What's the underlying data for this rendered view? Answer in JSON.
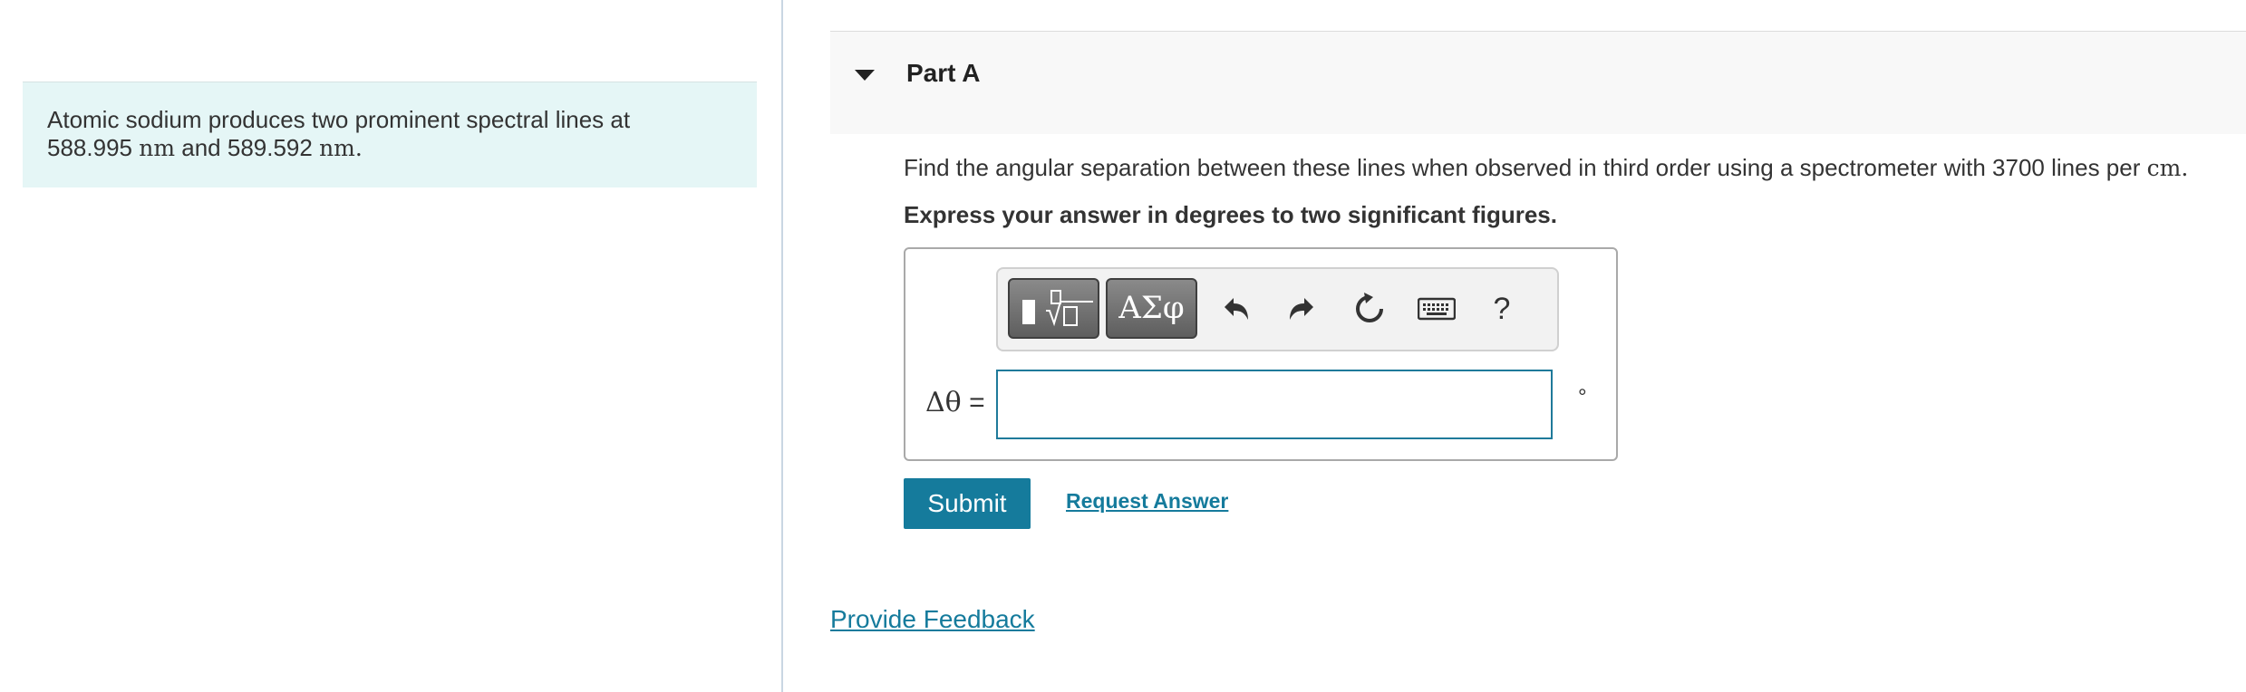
{
  "intro": {
    "text_prefix": "Atomic sodium produces two prominent spectral lines at",
    "line1_value": "588.995",
    "line1_unit": "nm",
    "and_text": " and ",
    "line2_value": "589.592",
    "line2_unit": "nm",
    "end": "."
  },
  "part": {
    "title": "Part A",
    "question_prefix": "Find the angular separation between these lines when observed in third order using a spectrometer with 3700 lines per ",
    "question_unit": "cm",
    "question_end": ".",
    "instruction": "Express your answer in degrees to two significant figures."
  },
  "toolbar": {
    "greek_label": "ΑΣφ",
    "help_label": "?",
    "icons": [
      "templates-icon",
      "greek-letters-icon",
      "undo-icon",
      "redo-icon",
      "reset-icon",
      "keyboard-icon",
      "help-icon"
    ]
  },
  "answer": {
    "label_symbol": "Δθ",
    "label_equals": " =",
    "value": "",
    "unit": "°"
  },
  "actions": {
    "submit_label": "Submit",
    "request_label": "Request Answer",
    "feedback_label": "Provide Feedback"
  },
  "colors": {
    "accent": "#157b9c",
    "intro_bg": "#e5f6f6",
    "header_bg": "#f8f8f8"
  }
}
